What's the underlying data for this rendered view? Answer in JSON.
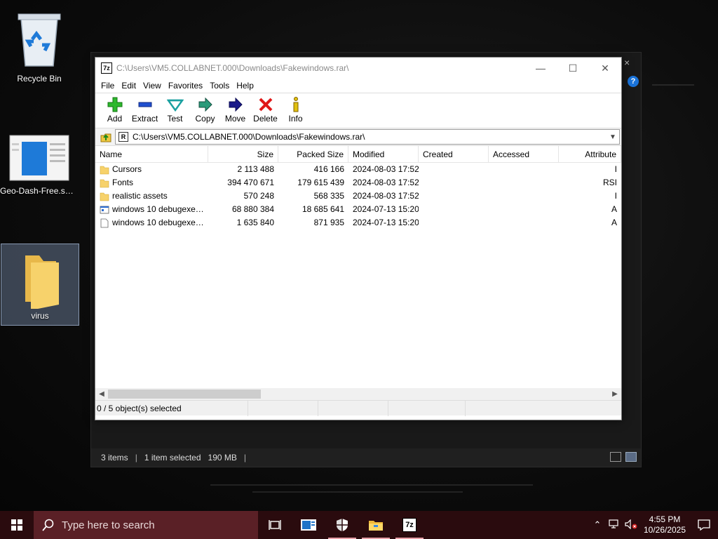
{
  "desktop": {
    "icons": [
      {
        "label": "Recycle Bin",
        "icon": "recycle-bin-icon"
      },
      {
        "label": "Geo-Dash-Free.sm...",
        "icon": "document-thumbnail-icon"
      },
      {
        "label": "virus",
        "icon": "folder-icon"
      }
    ]
  },
  "explorer": {
    "status": {
      "items": "3 items",
      "selected": "1 item selected",
      "size": "190 MB",
      "sep": "|"
    },
    "close_glyph": "×",
    "help_glyph": "?"
  },
  "zip": {
    "title": "C:\\Users\\VM5.COLLABNET.000\\Downloads\\Fakewindows.rar\\",
    "app_icon_text": "7z",
    "window_buttons": {
      "minimize": "—",
      "maximize": "☐",
      "close": "✕"
    },
    "menu": [
      "File",
      "Edit",
      "View",
      "Favorites",
      "Tools",
      "Help"
    ],
    "toolbar": [
      {
        "label": "Add",
        "icon": "add-icon"
      },
      {
        "label": "Extract",
        "icon": "extract-icon"
      },
      {
        "label": "Test",
        "icon": "test-icon"
      },
      {
        "label": "Copy",
        "icon": "copy-icon"
      },
      {
        "label": "Move",
        "icon": "move-icon"
      },
      {
        "label": "Delete",
        "icon": "delete-icon"
      },
      {
        "label": "Info",
        "icon": "info-icon"
      }
    ],
    "address": "C:\\Users\\VM5.COLLABNET.000\\Downloads\\Fakewindows.rar\\",
    "address_icon_text": "R",
    "columns": [
      "Name",
      "Size",
      "Packed Size",
      "Modified",
      "Created",
      "Accessed",
      "Attribute"
    ],
    "rows": [
      {
        "name": "Cursors",
        "type": "folder",
        "size": "2 113 488",
        "packed": "416 166",
        "modified": "2024-08-03 17:52",
        "created": "",
        "accessed": "",
        "attr": "I"
      },
      {
        "name": "Fonts",
        "type": "folder",
        "size": "394 470 671",
        "packed": "179 615 439",
        "modified": "2024-08-03 17:52",
        "created": "",
        "accessed": "",
        "attr": "RSI"
      },
      {
        "name": "realistic assets",
        "type": "folder",
        "size": "570 248",
        "packed": "568 335",
        "modified": "2024-08-03 17:52",
        "created": "",
        "accessed": "",
        "attr": "I"
      },
      {
        "name": "windows 10 debugexe.e...",
        "type": "exe",
        "size": "68 880 384",
        "packed": "18 685 641",
        "modified": "2024-07-13 15:20",
        "created": "",
        "accessed": "",
        "attr": "A"
      },
      {
        "name": "windows 10 debugexe.p...",
        "type": "file",
        "size": "1 635 840",
        "packed": "871 935",
        "modified": "2024-07-13 15:20",
        "created": "",
        "accessed": "",
        "attr": "A"
      }
    ],
    "status": "0 / 5 object(s) selected"
  },
  "taskbar": {
    "search_placeholder": "Type here to search",
    "time": "4:55 PM",
    "date": "10/26/2025",
    "apps": [
      {
        "icon": "task-view-icon"
      },
      {
        "icon": "news-icon"
      },
      {
        "icon": "security-shield-icon"
      },
      {
        "icon": "file-explorer-icon"
      },
      {
        "icon": "7zip-icon",
        "text": "7z"
      }
    ]
  },
  "colors": {
    "taskbar": "#2a0b0e",
    "search": "#5a2026",
    "accent": "#1a73d9"
  }
}
